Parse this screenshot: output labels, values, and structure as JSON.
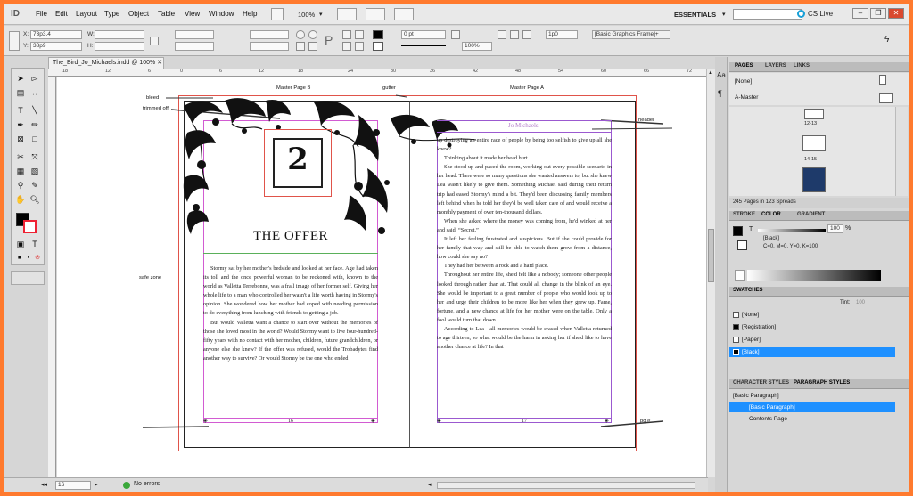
{
  "menubar": {
    "items": [
      "File",
      "Edit",
      "Layout",
      "Type",
      "Object",
      "Table",
      "View",
      "Window",
      "Help"
    ],
    "zoom": "100%",
    "workspace": "ESSENTIALS",
    "cslive": "CS Live",
    "window_buttons": [
      "–",
      "❐",
      "✕"
    ]
  },
  "control": {
    "x_label": "X:",
    "x_value": "73p3.4",
    "y_label": "Y:",
    "y_value": "38p9",
    "w_label": "W:",
    "h_label": "H:",
    "stroke_weight": "0 pt",
    "opacity": "100%",
    "gap": "1p0",
    "object_style": "[Basic Graphics Frame]+"
  },
  "document": {
    "tab_title": "The_Bird_Jo_Michaels.indd @ 100%",
    "ruler_ticks": [
      "18",
      "12",
      "6",
      "0",
      "6",
      "12",
      "18",
      "24",
      "30",
      "36",
      "42",
      "48",
      "54",
      "60",
      "66",
      "72"
    ]
  },
  "pages": {
    "left_master_label": "Master Page B",
    "right_master_label": "Master Page A",
    "gutter_label": "gutter",
    "bleed_label": "bleed",
    "trimmed_label": "trimmed off",
    "safe_label": "safe zone",
    "header_label": "header",
    "pg_label": "pg #",
    "chapter_number": "2",
    "chapter_title": "THE OFFER",
    "running_header": "Jo Michaels",
    "left_page_number": "16",
    "right_page_number": "17",
    "left_paragraphs": [
      "Stormy sat by her mother's bedside and looked at her face. Age had taken its toll and the once powerful woman to be reckoned with, known to the world as Valletta Terrebonne, was a frail image of her former self. Giving her whole life to a man who controlled her wasn't a life worth having in Stormy's opinion. She wondered how her mother had coped with needing permission to do everything from lunching with friends to getting a job.",
      "But would Valletta want a chance to start over without the memories of those she loved most in the world? Would Stormy want to live four-hundred-fifty years with no contact with her mother, children, future grandchildren, or anyone else she knew? If the offer was refused, would the Trobadytes find another way to survive? Or would Stormy be the one who ended"
    ],
    "right_paragraphs_first": "up destroying an entire race of people by being too selfish to give up all she knew?",
    "right_paragraphs": [
      "Thinking about it made her head hurt.",
      "She stood up and paced the room, working out every possible scenario in her head. There were so many questions she wanted answers to, but she knew Lea wasn't likely to give them. Something Michael said during their return trip had eased Stormy's mind a bit. They'd been discussing family members left behind when he told her they'd be well taken care of and would receive a monthly payment of over ten-thousand dollars.",
      "When she asked where the money was coming from, he'd winked at her and said, “Secret.”",
      "It left her feeling frustrated and suspicious. But if she could provide for her family that way and still be able to watch them grow from a distance, how could she say no?",
      "They had her between a rock and a hard place.",
      "Throughout her entire life, she'd felt like a nobody; someone other people looked through rather than at. That could all change in the blink of an eye. She would be important to a great number of people who would look up to her and urge their children to be more like her when they grew up. Fame, fortune, and a new chance at life for her mother were on the table. Only a fool would turn that down.",
      "According to Lea—all memories would be erased when Valletta returned to age thirteen, so what would be the harm in asking her if she'd like to have another chance at life? In that"
    ]
  },
  "status": {
    "page": "16",
    "errors": "No errors"
  },
  "pages_panel": {
    "tabs": [
      "PAGES",
      "LAYERS",
      "LINKS"
    ],
    "masters": [
      "[None]",
      "A-Master"
    ],
    "spread_labels": [
      "12-13",
      "14-15"
    ],
    "summary": "245 Pages in 123 Spreads"
  },
  "color_panel": {
    "tabs": [
      "STROKE",
      "COLOR",
      "GRADIENT"
    ],
    "tint_label": "T",
    "tint_value": "100",
    "percent": "%",
    "swatch_name": "[Black]",
    "cmyk": "C=0, M=0, Y=0, K=100"
  },
  "swatches_panel": {
    "title": "SWATCHES",
    "tint_label": "Tint:",
    "tint_value": "100",
    "items": [
      "[None]",
      "[Registration]",
      "[Paper]",
      "[Black]"
    ],
    "selected": "[Black]"
  },
  "styles_panel": {
    "tabs": [
      "CHARACTER STYLES",
      "PARAGRAPH STYLES"
    ],
    "current": "[Basic Paragraph]",
    "items": [
      "[Basic Paragraph]",
      "Contents Page"
    ],
    "selected": "[Basic Paragraph]"
  },
  "colors": {
    "frame": "#ff7a2e",
    "selection": "#1e90ff",
    "guide_magenta": "#d25bd2",
    "guide_purple": "#9b59d0",
    "bleed_red": "#e0534a"
  }
}
